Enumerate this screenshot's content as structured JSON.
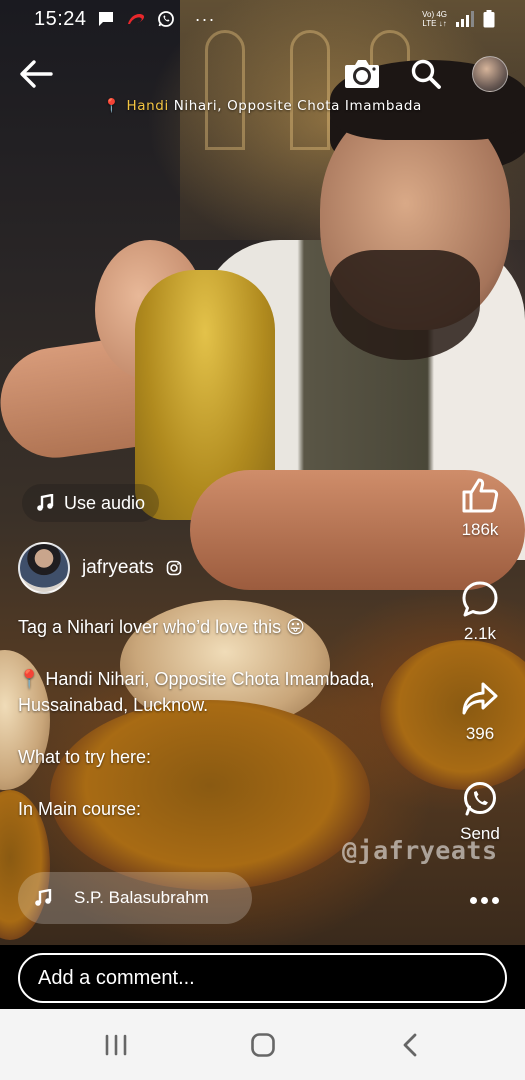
{
  "status_bar": {
    "time": "15:24",
    "notification_icons": [
      "message-icon",
      "airtel-icon",
      "whatsapp-icon",
      "more-dots-icon"
    ],
    "network_label_top": "Vo) 4G",
    "network_label_bottom": "LTE ↓↑"
  },
  "top_bar": {
    "back_icon": "arrow-left-icon",
    "camera_icon": "camera-icon",
    "search_icon": "search-icon"
  },
  "location_tag": {
    "highlight": "Handi",
    "rest": " Nihari, Opposite Chota Imambada"
  },
  "use_audio": {
    "label": "Use audio"
  },
  "actions": {
    "like_count": "186k",
    "comment_count": "2.1k",
    "share_count": "396",
    "send_label": "Send"
  },
  "author": {
    "username": "jafryeats",
    "verified_icon": "instagram-icon"
  },
  "caption": {
    "line1": "Tag a Nihari lover who’d love this 😛",
    "line2": "📍 Handi Nihari, Opposite Chota Imambada, Hussainabad, Lucknow.",
    "line3": "What to try here:",
    "line4": "In Main course:"
  },
  "watermark": "@jafryeats",
  "music": {
    "track": "S.P. Balasubrahm"
  },
  "comment": {
    "placeholder": "Add a comment..."
  },
  "colors": {
    "pin": "#e84a3a",
    "highlight": "#f4c542",
    "nav_bg": "#f4f4f4"
  }
}
